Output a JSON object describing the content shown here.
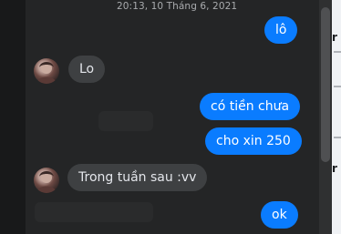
{
  "chat": {
    "timestamp": "20:13, 10 Tháng 6, 2021",
    "messages": [
      {
        "direction": "outgoing",
        "text": "lô"
      },
      {
        "direction": "incoming",
        "text": "Lo"
      },
      {
        "direction": "outgoing",
        "text": "có tiền chưa"
      },
      {
        "direction": "outgoing",
        "text": "cho xin 250"
      },
      {
        "direction": "incoming",
        "text": "Trong tuần sau :vv"
      },
      {
        "direction": "outgoing",
        "text": "ok"
      }
    ]
  },
  "colors": {
    "outgoing_bubble": "#0a7cff",
    "incoming_bubble": "#3e4042",
    "chat_background": "#242526",
    "timestamp_text": "#a9abae"
  }
}
